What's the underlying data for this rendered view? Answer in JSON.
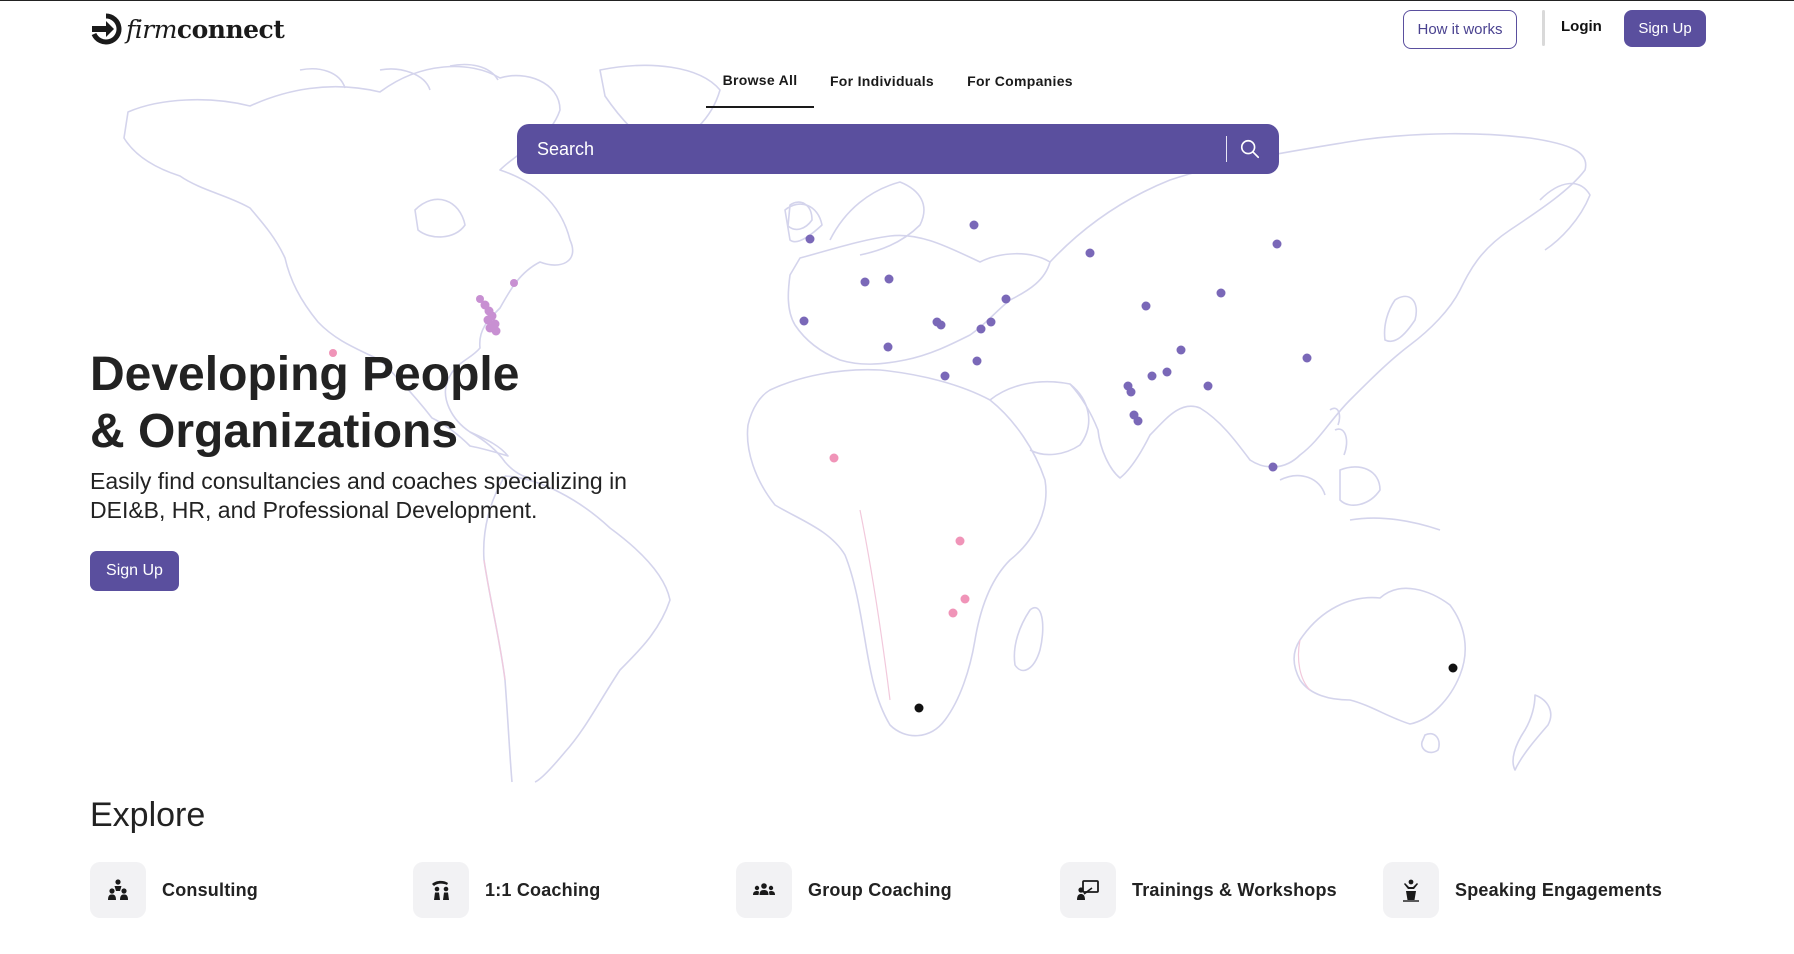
{
  "header": {
    "logo_light": "firm",
    "logo_bold": "connect",
    "how_it_works": "How it works",
    "login": "Login",
    "signup": "Sign Up"
  },
  "tabs": [
    {
      "label": "Browse All",
      "active": true
    },
    {
      "label": "For Individuals",
      "active": false
    },
    {
      "label": "For Companies",
      "active": false
    }
  ],
  "search": {
    "placeholder": "Search"
  },
  "hero": {
    "title_line1": "Developing People",
    "title_line2": "& Organizations",
    "subtitle_line1": "Easily find consultancies and coaches specializing in",
    "subtitle_line2": "DEI&B, HR, and Professional Development.",
    "cta": "Sign Up"
  },
  "explore": {
    "title": "Explore",
    "categories": [
      {
        "label": "Consulting",
        "icon": "consulting-icon"
      },
      {
        "label": "1:1 Coaching",
        "icon": "coaching-icon"
      },
      {
        "label": "Group Coaching",
        "icon": "group-coaching-icon"
      },
      {
        "label": "Trainings & Workshops",
        "icon": "training-icon"
      },
      {
        "label": "Speaking Engagements",
        "icon": "speaking-icon"
      }
    ]
  },
  "colors": {
    "brand": "#5a4f9e",
    "pin_purple": "#7a68b8",
    "pin_lilac": "#c890d2",
    "pin_pink": "#f094b8",
    "pin_black": "#111111"
  }
}
